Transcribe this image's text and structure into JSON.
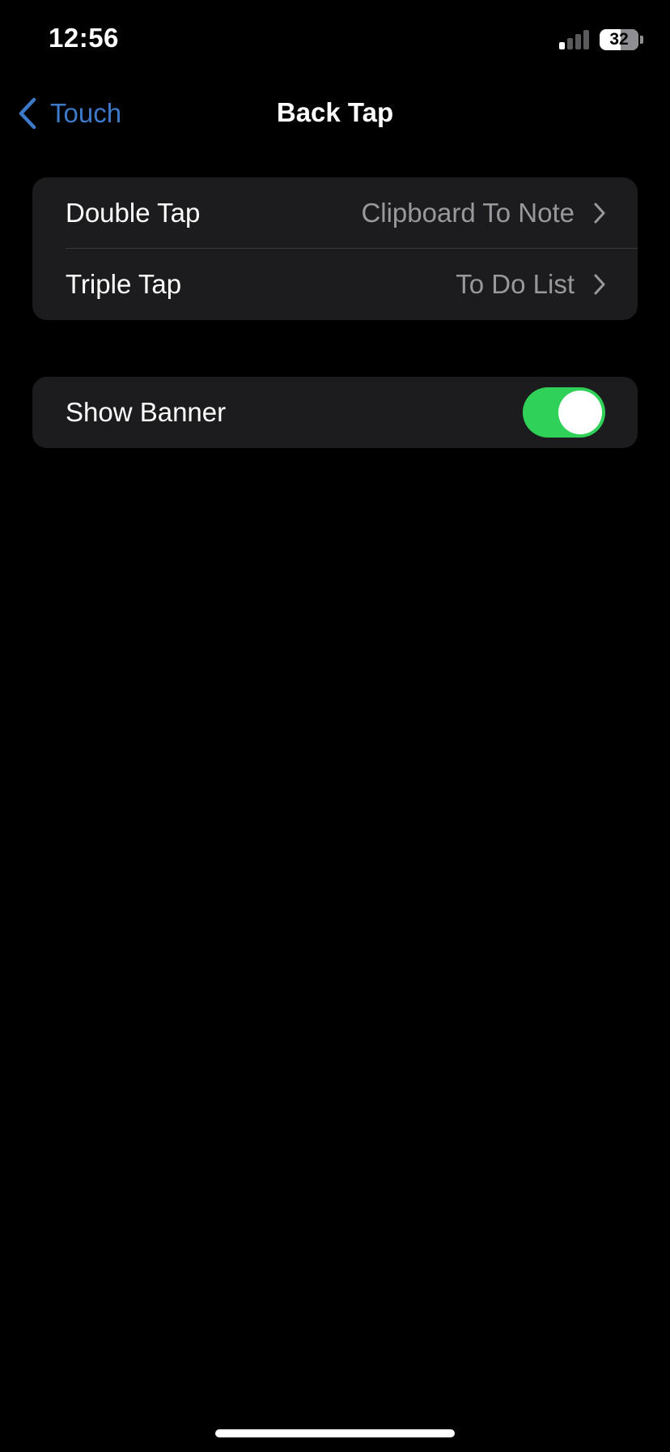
{
  "status_bar": {
    "time": "12:56",
    "battery_level": "32",
    "icons": [
      "signal-icon",
      "battery-icon"
    ]
  },
  "nav": {
    "back_label": "Touch",
    "back_icon": "chevron-left-icon",
    "title": "Back Tap"
  },
  "settings": {
    "gestures": [
      {
        "label": "Double Tap",
        "value": "Clipboard To Note",
        "icon": "chevron-right-icon"
      },
      {
        "label": "Triple Tap",
        "value": "To Do List",
        "icon": "chevron-right-icon"
      }
    ],
    "banner": {
      "label": "Show Banner",
      "enabled": true
    }
  },
  "colors": {
    "background": "#000000",
    "group_background": "#1c1c1e",
    "accent": "#3d79c9",
    "toggle_on": "#30d158",
    "secondary_text": "#98989d"
  }
}
